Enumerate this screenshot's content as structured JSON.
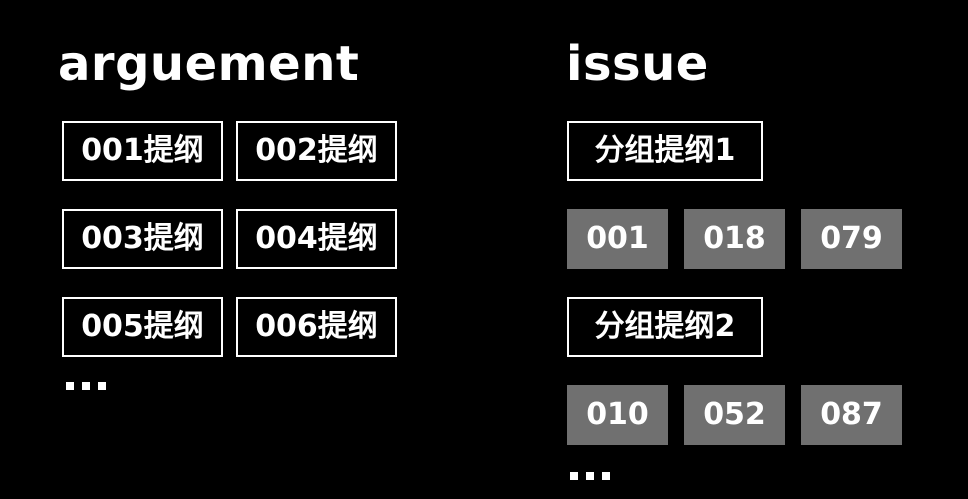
{
  "colors": {
    "background": "#000000",
    "text": "#ffffff",
    "outline": "#ffffff",
    "filled_box": "#707070"
  },
  "argument": {
    "title": "arguement",
    "items": [
      "001提纲",
      "002提纲",
      "003提纲",
      "004提纲",
      "005提纲",
      "006提纲"
    ],
    "more": "..."
  },
  "issue": {
    "title": "issue",
    "groups": [
      {
        "label": "分组提纲1",
        "items": [
          "001",
          "018",
          "079"
        ]
      },
      {
        "label": "分组提纲2",
        "items": [
          "010",
          "052",
          "087"
        ]
      }
    ],
    "more": "..."
  }
}
